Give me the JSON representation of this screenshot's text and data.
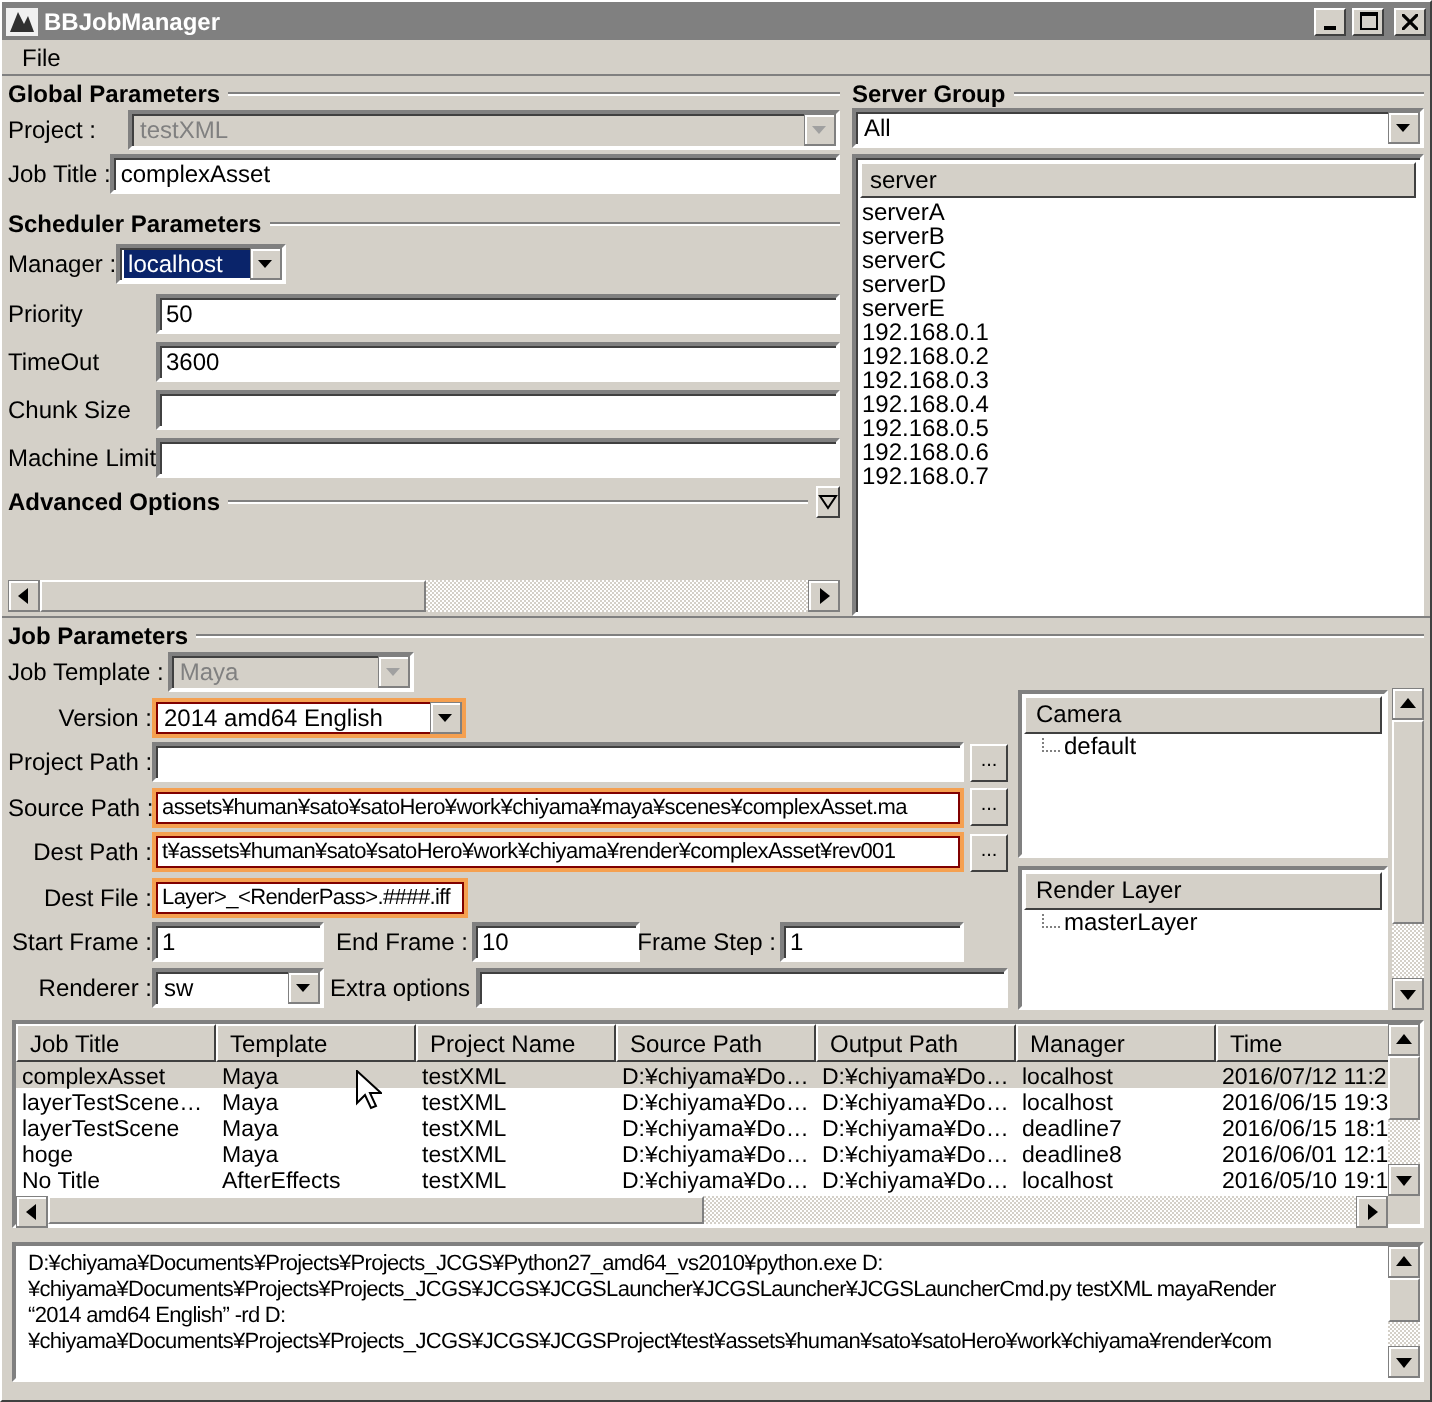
{
  "window": {
    "title": "BBJobManager"
  },
  "menu": [
    "File"
  ],
  "global_parameters": {
    "heading": "Global Parameters",
    "project": {
      "label": "Project :",
      "value": "testXML",
      "disabled": true
    },
    "job_title": {
      "label": "Job Title :",
      "value": "complexAsset"
    }
  },
  "scheduler_parameters": {
    "heading": "Scheduler Parameters",
    "manager": {
      "label": "Manager :",
      "value": "localhost",
      "focused": true
    },
    "fields": [
      {
        "label": "Priority",
        "value": "50"
      },
      {
        "label": "TimeOut",
        "value": "3600"
      },
      {
        "label": "Chunk Size"
      },
      {
        "label": "Machine Limit"
      }
    ]
  },
  "advanced_options": {
    "heading": "Advanced Options",
    "expanded": false
  },
  "server_group": {
    "heading": "Server Group",
    "group": "All",
    "column": "server",
    "servers": [
      "serverA",
      "serverB",
      "serverC",
      "serverD",
      "serverE",
      "192.168.0.1",
      "192.168.0.2",
      "192.168.0.3",
      "192.168.0.4",
      "192.168.0.5",
      "192.168.0.6",
      "192.168.0.7"
    ]
  },
  "job_parameters": {
    "heading": "Job Parameters",
    "template": {
      "label": "Job Template :",
      "value": "Maya",
      "disabled": true
    },
    "version": {
      "label": "Version :",
      "value": "2014 amd64 English",
      "highlighted": true
    },
    "paths": [
      {
        "label": "Project Path :",
        "highlighted": false,
        "browse": "..."
      },
      {
        "label": "Source Path :",
        "value": "assets¥human¥sato¥satoHero¥work¥chiyama¥maya¥scenes¥complexAsset.ma",
        "highlighted": true,
        "browse": "..."
      },
      {
        "label": "Dest Path :",
        "value": "t¥assets¥human¥sato¥satoHero¥work¥chiyama¥render¥complexAsset¥rev001",
        "highlighted": true,
        "browse": "..."
      }
    ],
    "dest_file": {
      "label": "Dest File :",
      "value": "Layer>_<RenderPass>.####.iff",
      "highlighted": true
    },
    "start_frame": {
      "label": "Start Frame :",
      "value": "1"
    },
    "end_frame": {
      "label": "End Frame :",
      "value": "10"
    },
    "frame_step": {
      "label": "Frame Step :",
      "value": "1"
    },
    "renderer": {
      "label": "Renderer :",
      "value": "sw"
    },
    "extra_options": {
      "label": "Extra options"
    },
    "camera": {
      "heading": "Camera",
      "items": [
        "default"
      ]
    },
    "render_layer": {
      "heading": "Render Layer",
      "items": [
        "masterLayer"
      ]
    }
  },
  "jobs_table": {
    "columns": [
      "Job Title",
      "Template",
      "Project Name",
      "Source Path",
      "Output Path",
      "Manager",
      "Time"
    ],
    "rows": [
      {
        "selected": true,
        "cells": [
          "complexAsset",
          "Maya",
          "testXML",
          "D:¥chiyama¥Do…",
          "D:¥chiyama¥Do…",
          "localhost",
          "2016/07/12 11:2"
        ]
      },
      {
        "selected": false,
        "cells": [
          "layerTestScene…",
          "Maya",
          "testXML",
          "D:¥chiyama¥Do…",
          "D:¥chiyama¥Do…",
          "localhost",
          "2016/06/15 19:3"
        ]
      },
      {
        "selected": false,
        "cells": [
          "layerTestScene",
          "Maya",
          "testXML",
          "D:¥chiyama¥Do…",
          "D:¥chiyama¥Do…",
          "deadline7",
          "2016/06/15 18:1"
        ]
      },
      {
        "selected": false,
        "cells": [
          "hoge",
          "Maya",
          "testXML",
          "D:¥chiyama¥Do…",
          "D:¥chiyama¥Do…",
          "deadline8",
          "2016/06/01 12:1"
        ]
      },
      {
        "selected": false,
        "cells": [
          "No Title",
          "AfterEffects",
          "testXML",
          "D:¥chiyama¥Do…",
          "D:¥chiyama¥Do…",
          "localhost",
          "2016/05/10 19:1"
        ]
      }
    ]
  },
  "log": {
    "lines": [
      "D:¥chiyama¥Documents¥Projects¥Projects_JCGS¥Python27_amd64_vs2010¥python.exe D:",
      "¥chiyama¥Documents¥Projects¥Projects_JCGS¥JCGS¥JCGSLauncher¥JCGSLauncher¥JCGSLauncherCmd.py testXML mayaRender",
      "“2014 amd64 English” -rd D:",
      "¥chiyama¥Documents¥Projects¥Projects_JCGS¥JCGS¥JCGSProject¥test¥assets¥human¥sato¥satoHero¥work¥chiyama¥render¥com"
    ]
  }
}
